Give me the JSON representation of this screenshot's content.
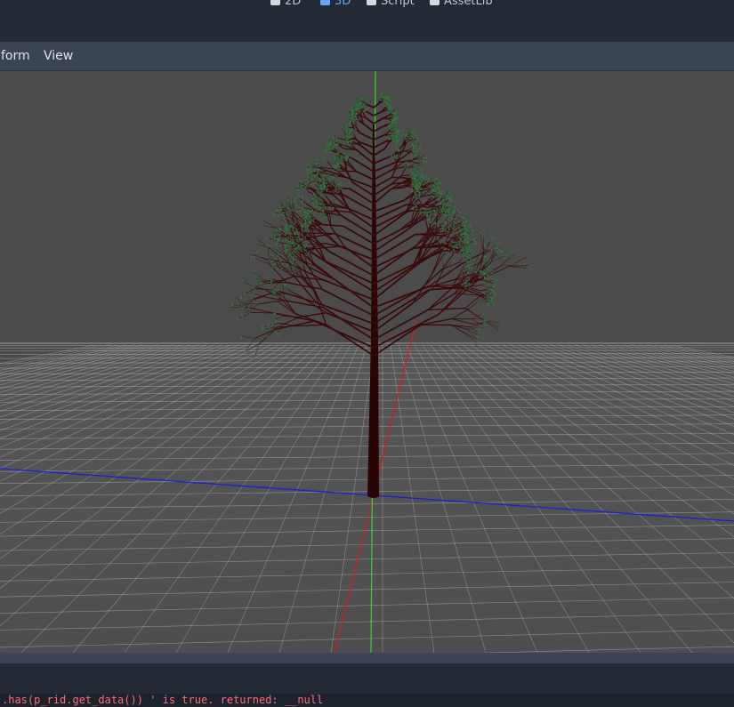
{
  "main_tabs": [
    {
      "label": "2D",
      "icon": "2d-icon",
      "active": false
    },
    {
      "label": "3D",
      "icon": "3d-icon",
      "active": true
    },
    {
      "label": "Script",
      "icon": "script-icon",
      "active": false
    },
    {
      "label": "AssetLib",
      "icon": "assetlib-icon",
      "active": false
    }
  ],
  "viewport_menu": {
    "transform_label": "form",
    "view_label": "View"
  },
  "output": {
    "error_line": ".has(p_rid.get_data()) ' is true. returned: __null"
  },
  "colors": {
    "accent": "#6ba3ff",
    "error": "#ff6a7d",
    "x_axis": "#d21e1e",
    "y_axis": "#30d630",
    "z_axis": "#1e1ed6",
    "viewport_bg": "#4b4b4b"
  }
}
